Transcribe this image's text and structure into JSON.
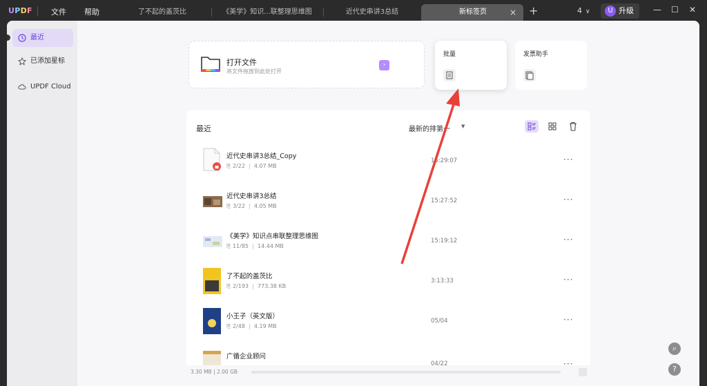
{
  "titlebar": {
    "logo": "UPDF",
    "menu": [
      "文件",
      "帮助"
    ],
    "tabs": [
      {
        "label": "了不起的盖茨比"
      },
      {
        "label": "《美学》知识...联整理思维图"
      },
      {
        "label": "近代史串讲3总结"
      },
      {
        "label": "新标签页",
        "active": true
      }
    ],
    "add_tab": "+",
    "close": "×",
    "window_count": "4",
    "upgrade_badge": "U",
    "upgrade_label": "升级",
    "win_min": "—",
    "win_max": "☐",
    "win_close": "✕"
  },
  "sidebar": {
    "items": [
      {
        "label": "最近",
        "icon": "clock-icon",
        "active": true
      },
      {
        "label": "已添加星标",
        "icon": "star-icon"
      },
      {
        "label": "UPDF Cloud",
        "icon": "cloud-icon"
      }
    ]
  },
  "main": {
    "open_file": {
      "title": "打开文件",
      "subtitle": "将文件拖放到此处打开",
      "arrow": "›"
    },
    "batch": {
      "title": "批量"
    },
    "invoice": {
      "title": "发票助手"
    },
    "recent": {
      "label": "最近",
      "sort_label": "最新的排第一",
      "files": [
        {
          "name": "近代史串讲3总结_Copy",
          "pages": "2/22",
          "size": "4.07 MB",
          "time": "15:29:07",
          "locked": true
        },
        {
          "name": "近代史串讲3总结",
          "pages": "3/22",
          "size": "4.05 MB",
          "time": "15:27:52"
        },
        {
          "name": "《美学》知识点串联整理思维图",
          "pages": "11/85",
          "size": "14.44 MB",
          "time": "15:19:12"
        },
        {
          "name": "了不起的盖茨比",
          "pages": "2/193",
          "size": "773.38 KB",
          "time": "3:13:33"
        },
        {
          "name": "小王子（英文版）",
          "pages": "2/48",
          "size": "4.19 MB",
          "time": "05/04"
        },
        {
          "name": "广循企业顾问",
          "pages": "",
          "size": "",
          "time": "04/22"
        }
      ],
      "more": "···"
    },
    "storage": {
      "text": "3.30 MB | 2.00 GB",
      "used_fraction": 0.0016
    }
  },
  "floating": {
    "search": "⌕",
    "help": "?"
  },
  "colors": {
    "accent": "#8b5cf6",
    "arrow": "#e8413a",
    "titlebar": "#2b2b2b"
  }
}
